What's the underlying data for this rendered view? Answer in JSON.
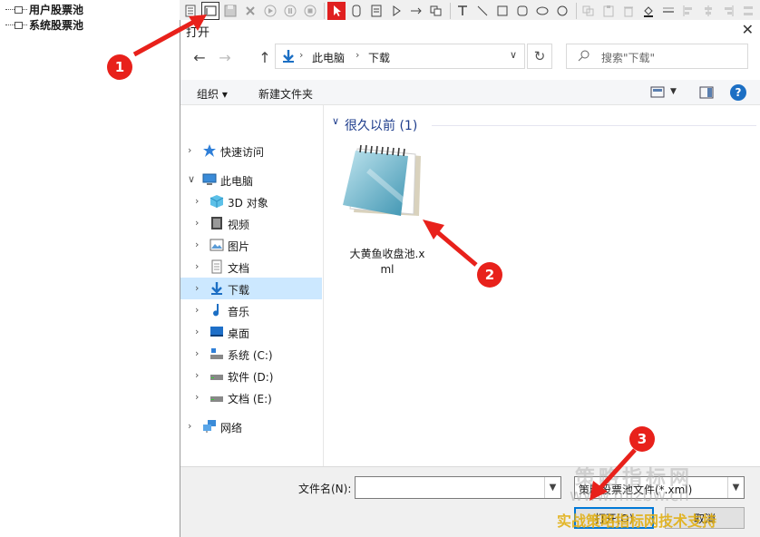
{
  "left_tree": {
    "items": [
      "用户股票池",
      "系统股票池"
    ]
  },
  "toolbar": {
    "buttons": [
      "document-icon",
      "open-icon",
      "save-icon",
      "delete-icon",
      "play-icon",
      "pause-icon",
      "stop-icon",
      "select-arrow-icon",
      "rounded-rect-icon",
      "note-icon",
      "triangle-icon",
      "arrow-right-icon",
      "copy-icon",
      "text-tool-icon",
      "line-icon",
      "square-icon",
      "rounded-square-icon",
      "ellipse-icon",
      "circle-icon",
      "copy-disabled-icon",
      "paste-disabled-icon",
      "trash-disabled-icon",
      "fill-icon",
      "line-width-icon",
      "align-left-icon",
      "align-center-icon",
      "align-right-icon",
      "distribute-icon"
    ]
  },
  "dialog": {
    "title": "打开",
    "close_glyph": "✕",
    "nav": {
      "back_glyph": "←",
      "forward_glyph": "→",
      "up_glyph": "↑",
      "breadcrumb": [
        "此电脑",
        "下载"
      ],
      "breadcrumb_sep": "›",
      "dropdown_glyph": "∨",
      "refresh_glyph": "↻",
      "search_placeholder": "搜索\"下载\""
    },
    "commands": {
      "organize": "组织 ▾",
      "new_folder": "新建文件夹",
      "help": "?"
    },
    "nav_pane": [
      {
        "label": "快速访问",
        "icon": "star-icon",
        "level": 0,
        "selected": false
      },
      {
        "label": "此电脑",
        "icon": "computer-icon",
        "level": 0,
        "selected": false,
        "expanded": true
      },
      {
        "label": "3D 对象",
        "icon": "cube-3d-icon",
        "level": 1,
        "selected": false
      },
      {
        "label": "视频",
        "icon": "video-icon",
        "level": 1,
        "selected": false
      },
      {
        "label": "图片",
        "icon": "picture-icon",
        "level": 1,
        "selected": false
      },
      {
        "label": "文档",
        "icon": "document-icon",
        "level": 1,
        "selected": false
      },
      {
        "label": "下载",
        "icon": "download-icon",
        "level": 1,
        "selected": true
      },
      {
        "label": "音乐",
        "icon": "music-icon",
        "level": 1,
        "selected": false
      },
      {
        "label": "桌面",
        "icon": "desktop-icon",
        "level": 1,
        "selected": false
      },
      {
        "label": "系统 (C:)",
        "icon": "drive-c-icon",
        "level": 1,
        "selected": false
      },
      {
        "label": "软件 (D:)",
        "icon": "drive-icon",
        "level": 1,
        "selected": false
      },
      {
        "label": "文档 (E:)",
        "icon": "drive-icon",
        "level": 1,
        "selected": false
      },
      {
        "label": "网络",
        "icon": "network-icon",
        "level": 0,
        "selected": false
      }
    ],
    "content": {
      "group_header": "很久以前 (1)",
      "file_name": "大黄鱼收盘池.xml",
      "file_icon": "notepad-icon"
    },
    "bottom": {
      "filename_label": "文件名(N):",
      "filename_value": "",
      "filetype_value": "策略股票池文件(*.xml)",
      "open_button": "打开(O)",
      "cancel_button": "取消"
    }
  },
  "annotations": {
    "badges": [
      "1",
      "2",
      "3"
    ],
    "badge_color": "#e8211b"
  },
  "watermark": {
    "line1": "策略指标网",
    "line2": "www.mlzbw.cn",
    "line3": "实战策略指标网技术支持"
  },
  "colors": {
    "selection": "#cce8ff",
    "accent": "#0078d7",
    "header_blue": "#1e3d8c"
  }
}
